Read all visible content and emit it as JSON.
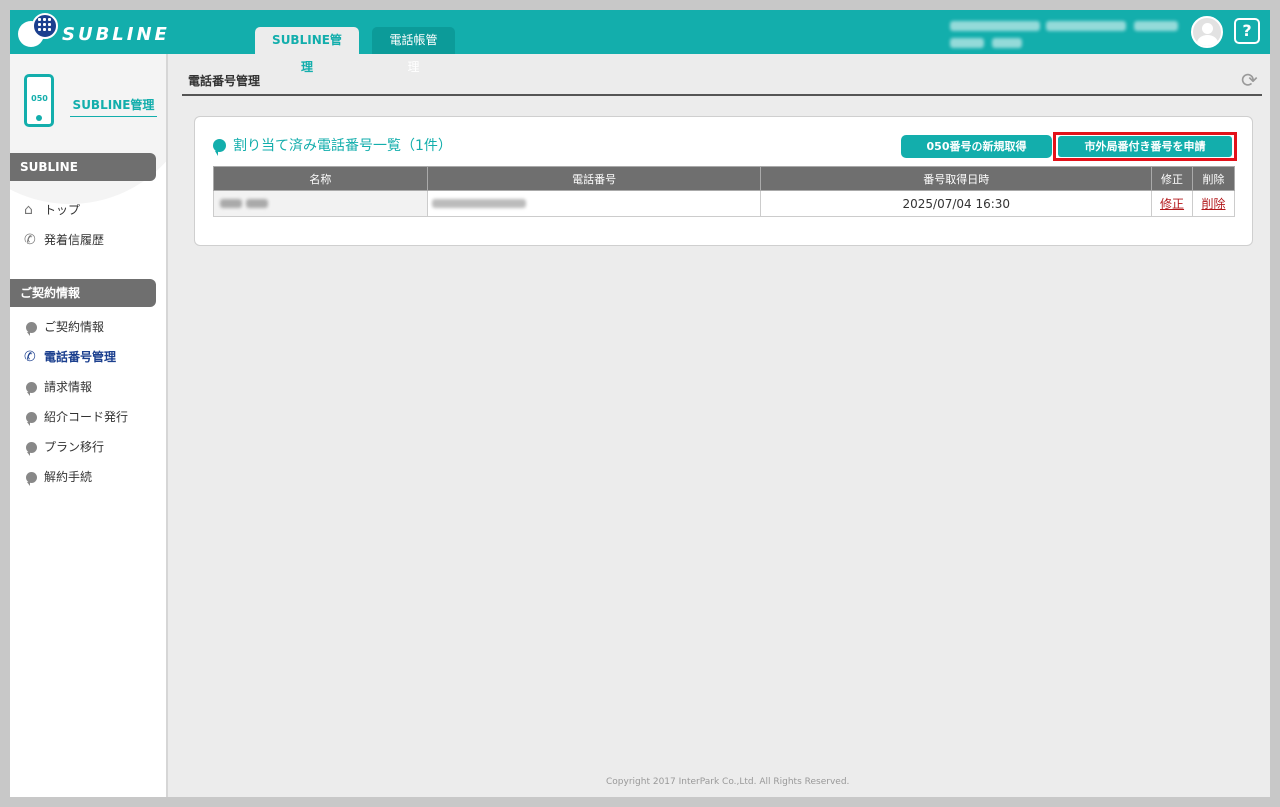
{
  "header": {
    "logo_text": "SUBLINE",
    "tabs": [
      {
        "label": "SUBLINE管理",
        "active": true
      },
      {
        "label": "電話帳管理",
        "active": false
      }
    ],
    "help_label": "?"
  },
  "sidebar": {
    "phone_number_label": "050",
    "title": "SUBLINE管理",
    "sections": [
      {
        "label": "SUBLINE",
        "items": [
          {
            "label": "トップ",
            "icon": "home-icon"
          },
          {
            "label": "発着信履歴",
            "icon": "phone-history-icon"
          }
        ]
      },
      {
        "label": "ご契約情報",
        "items": [
          {
            "label": "ご契約情報",
            "icon": "bubble-icon"
          },
          {
            "label": "電話番号管理",
            "icon": "phone-icon",
            "active": true
          },
          {
            "label": "請求情報",
            "icon": "bubble-icon"
          },
          {
            "label": "紹介コード発行",
            "icon": "bubble-icon"
          },
          {
            "label": "プラン移行",
            "icon": "bubble-icon"
          },
          {
            "label": "解約手続",
            "icon": "bubble-icon"
          }
        ]
      }
    ]
  },
  "main": {
    "title": "電話番号管理",
    "card": {
      "heading": "割り当て済み電話番号一覧（1件）",
      "button_new": "050番号の新規取得",
      "button_apply": "市外局番付き番号を申請",
      "table": {
        "headers": [
          "名称",
          "電話番号",
          "番号取得日時",
          "修正",
          "削除"
        ],
        "rows": [
          {
            "date": "2025/07/04 16:30",
            "edit": "修正",
            "delete": "削除"
          }
        ]
      }
    }
  },
  "footer": {
    "copyright": "Copyright 2017 InterPark Co.,Ltd. All Rights Reserved."
  },
  "colors": {
    "accent": "#13aeac",
    "highlight": "#e3121a",
    "link": "#b3191c"
  }
}
